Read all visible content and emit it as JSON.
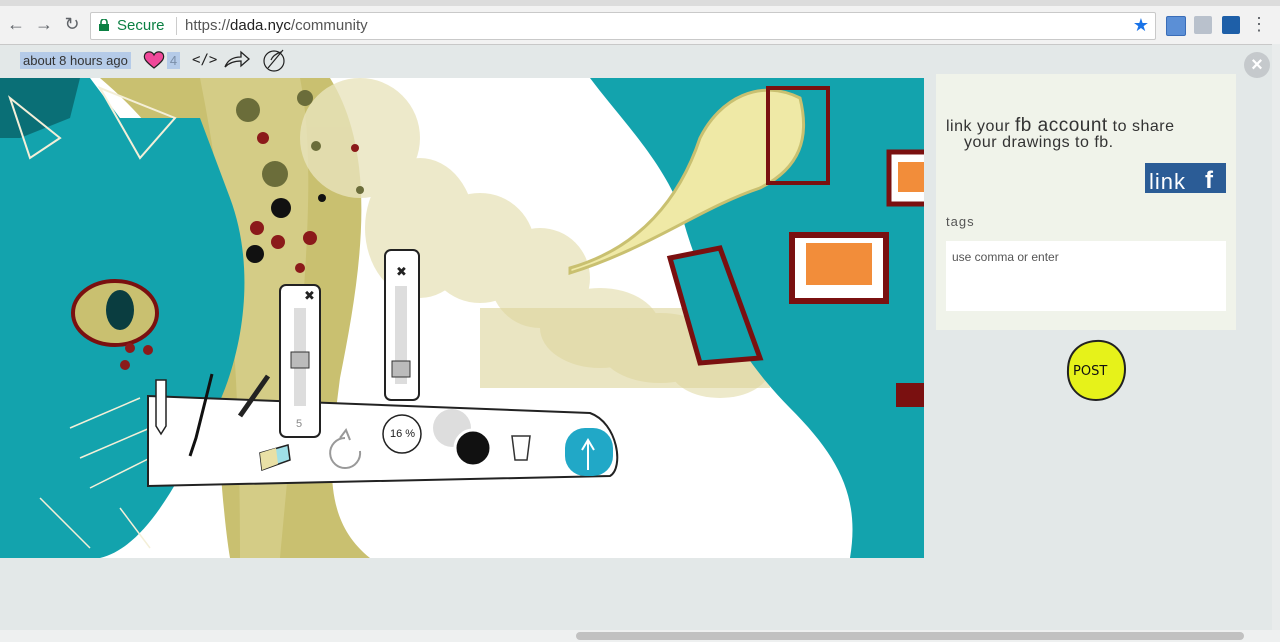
{
  "browser": {
    "secure_label": "Secure",
    "url_scheme": "https://",
    "url_host": "dada.nyc",
    "url_path": "/community"
  },
  "post_meta": {
    "time_ago": "about 8 hours ago",
    "likes": "4",
    "embed_label": "</>"
  },
  "toolbar": {
    "brush_size": "5",
    "opacity": "16 %"
  },
  "panel": {
    "fb_text_1": "link your",
    "fb_text_2": "fb account",
    "fb_text_3": "to share",
    "fb_text_4": "your drawings to fb.",
    "link_button": "link",
    "fb_letter": "f",
    "tags_label": "tags",
    "tags_placeholder": "use comma or enter",
    "post_label": "POST"
  },
  "colors": {
    "accent_teal": "#13a3ad",
    "accent_olive": "#c9c070",
    "fb_blue": "#2b5c96",
    "post_yellow": "#e6f21a"
  }
}
